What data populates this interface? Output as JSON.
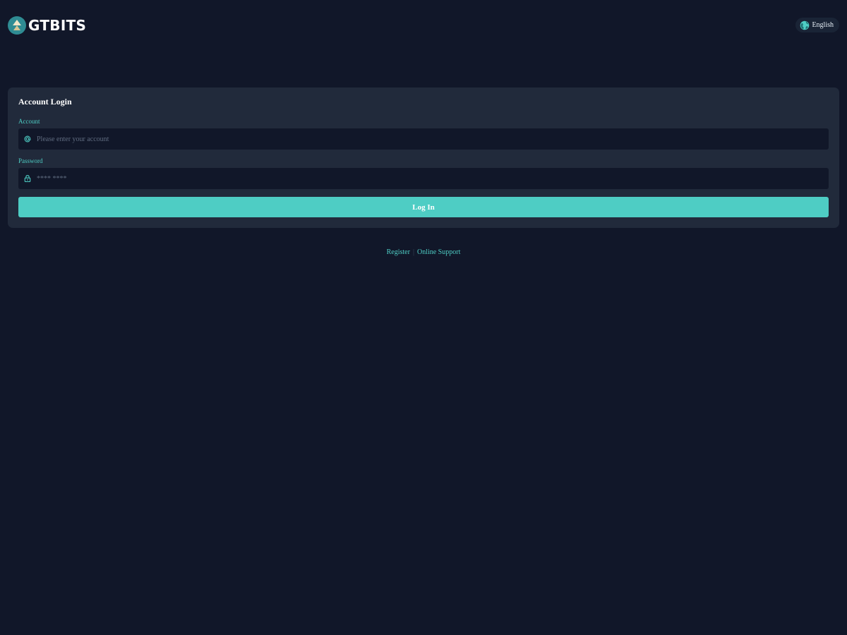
{
  "brand": {
    "name": "GTBITS",
    "logo_icon": "gtbits-logo-icon"
  },
  "language": {
    "label": "English",
    "icon": "globe-icon"
  },
  "login": {
    "title": "Account Login",
    "account_label": "Account",
    "account_placeholder": "Please enter your account",
    "account_value": "",
    "account_icon": "at-sign-icon",
    "password_label": "Password",
    "password_placeholder": "**** ****",
    "password_value": "",
    "password_icon": "lock-icon",
    "submit_label": "Log In"
  },
  "footer": {
    "register_label": "Register",
    "separator": "|",
    "support_label": "Online Support"
  },
  "colors": {
    "background": "#111729",
    "card": "#212a3b",
    "accent": "#4ecdc4"
  }
}
